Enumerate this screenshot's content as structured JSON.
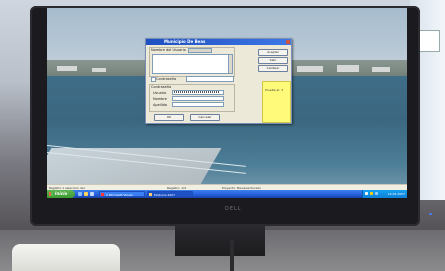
{
  "monitor": {
    "brand": "DELL"
  },
  "dialog": {
    "title": "Municipio De Beas",
    "labels": {
      "section1": "Nombre del Usuario",
      "section2": "Contraseña",
      "row1": "Usuario",
      "row2": "Nombre",
      "row3": "Apellido",
      "checkbox": "Contraseña"
    },
    "buttons": {
      "aceptar": "Aceptar",
      "salir": "Salir",
      "cambiar": "Cambiar",
      "ok": "OK",
      "cancelar": "Cancelar"
    },
    "sticky_text": "Prueba el: 3"
  },
  "statusbar": {
    "left": "Registro 1 seleccion del",
    "middle": "Registro: 1/4",
    "right": "Proyecto: Bienaventurado"
  },
  "taskbar": {
    "start_label": "Inicio",
    "tasks": [
      {
        "label": "2 Microsoft Visual"
      },
      {
        "label": "Modulos 2007"
      }
    ],
    "clock": "10:04 2007"
  },
  "colors": {
    "taskbar": "#245edb",
    "start": "#3c9a32",
    "sticky": "#fffa7a",
    "dialog_title": "#1d4fbf"
  }
}
